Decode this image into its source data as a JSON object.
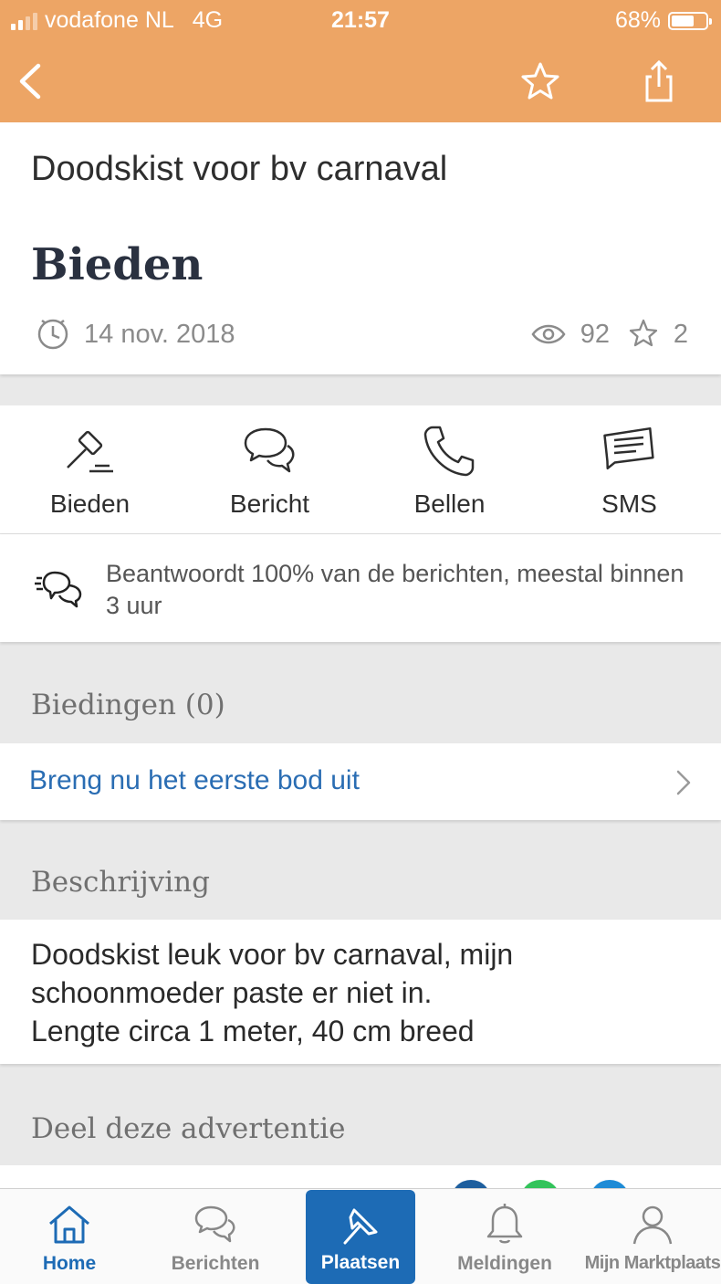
{
  "status_bar": {
    "carrier": "vodafone NL",
    "network": "4G",
    "time": "21:57",
    "battery": "68%",
    "battery_level": 0.68
  },
  "nav": {
    "back_icon": "chevron-left-icon",
    "favorite_icon": "star-outline-icon",
    "share_icon": "share-icon"
  },
  "listing": {
    "title": "Doodskist voor bv carnaval",
    "price": "Bieden",
    "date": "14 nov. 2018",
    "views": "92",
    "favorites": "2"
  },
  "actions": [
    {
      "label": "Bieden",
      "icon": "gavel-icon"
    },
    {
      "label": "Bericht",
      "icon": "chat-bubbles-icon"
    },
    {
      "label": "Bellen",
      "icon": "phone-icon"
    },
    {
      "label": "SMS",
      "icon": "sms-icon"
    }
  ],
  "response_info": {
    "text": "Beantwoordt 100% van de berichten, meestal binnen 3 uur",
    "icon": "fast-reply-icon"
  },
  "bids": {
    "heading": "Biedingen (0)",
    "cta": "Breng nu het eerste bod uit"
  },
  "description": {
    "heading": "Beschrijving",
    "lines": [
      "Doodskist leuk voor bv carnaval, mijn",
      "schoonmoeder paste er niet in.",
      "Lengte circa 1 meter, 40 cm breed"
    ]
  },
  "share": {
    "heading": "Deel deze advertentie"
  },
  "tabs": [
    {
      "label": "Home",
      "icon": "home-icon",
      "active": true
    },
    {
      "label": "Berichten",
      "icon": "chat-bubbles-icon",
      "active": false
    },
    {
      "label": "Plaatsen",
      "icon": "pin-icon",
      "active": false
    },
    {
      "label": "Meldingen",
      "icon": "bell-icon",
      "active": false
    },
    {
      "label": "Mijn Marktplaats",
      "icon": "user-icon",
      "active": false
    }
  ],
  "colors": {
    "header": "#eda565",
    "accent": "#1d6bb5",
    "link": "#2a6db3"
  }
}
